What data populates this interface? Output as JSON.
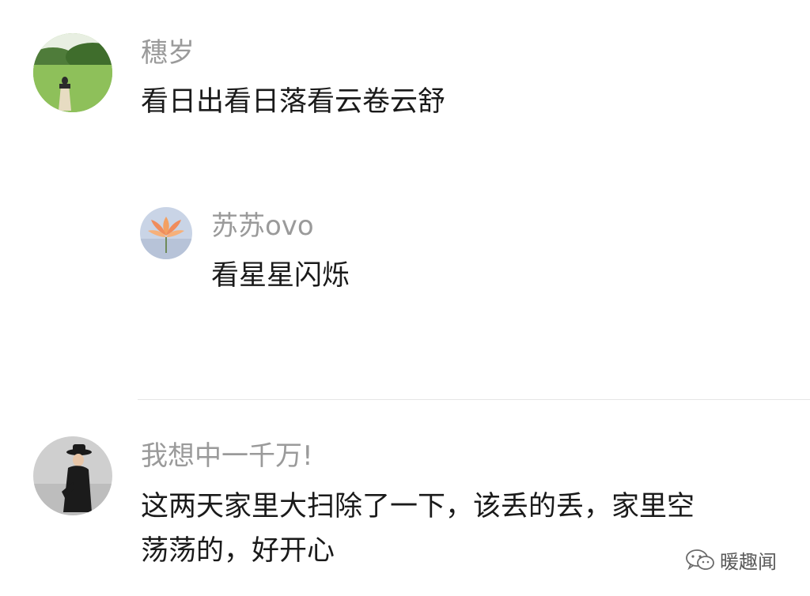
{
  "comments": [
    {
      "username": "穗岁",
      "content": "看日出看日落看云卷云舒",
      "avatar": "woman-on-grass-avatar"
    },
    {
      "username": "苏苏ovo",
      "content": "看星星闪烁",
      "avatar": "lotus-flower-avatar",
      "is_reply": true
    },
    {
      "username": "我想中一千万!",
      "content_lines": [
        "这两天家里大扫除了一下，该丢的丢，家里空",
        "荡荡的，好开心"
      ],
      "avatar": "woman-in-black-hat-avatar"
    }
  ],
  "watermark": {
    "text": "暖趣闻",
    "icon": "wechat-icon"
  },
  "colors": {
    "username": "#9a9a9a",
    "content": "#1a1a1a",
    "divider": "#e6e6e6",
    "background": "#ffffff"
  }
}
